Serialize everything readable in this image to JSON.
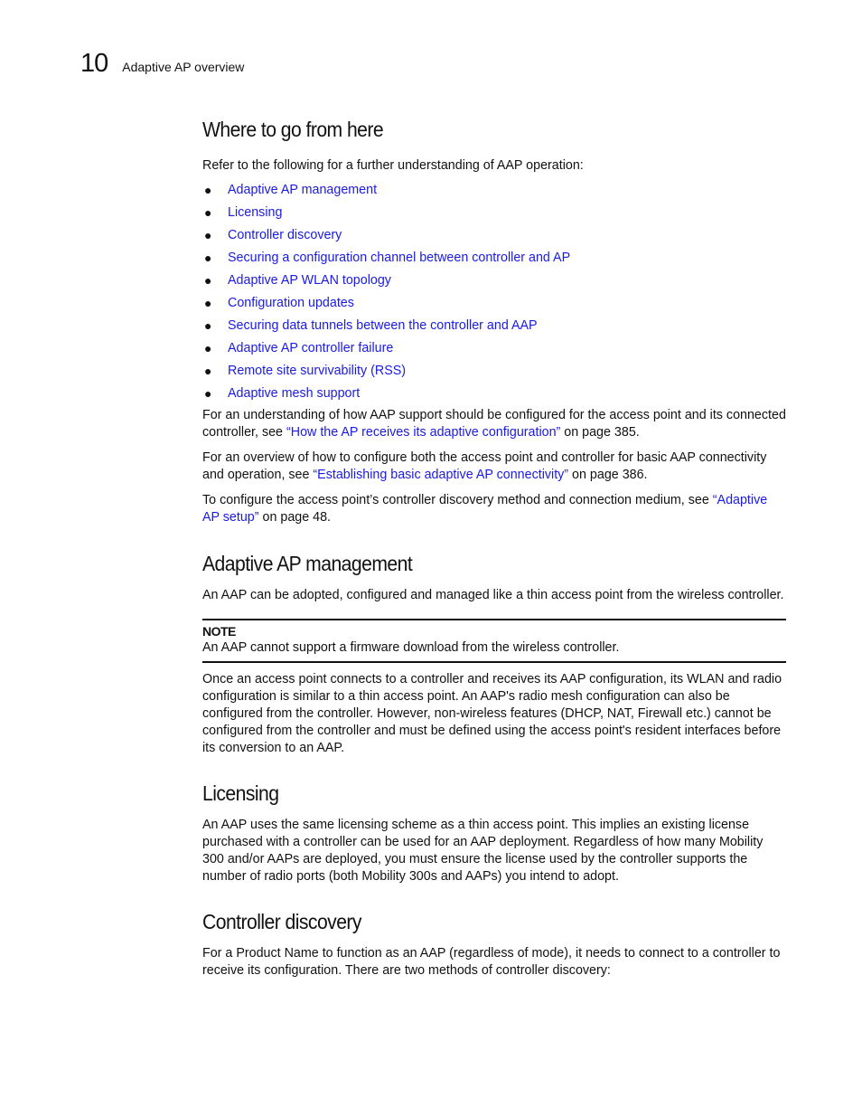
{
  "running_head": {
    "chapter_number": "10",
    "chapter_title": "Adaptive AP overview"
  },
  "sections": {
    "where_to_go": {
      "heading": "Where to go from here",
      "intro": "Refer to the following for a further understanding of AAP operation:",
      "links": [
        "Adaptive AP management",
        "Licensing",
        "Controller discovery",
        "Securing a configuration channel between controller and AP",
        "Adaptive AP WLAN topology",
        "Configuration updates",
        "Securing data tunnels between the controller and AAP",
        "Adaptive AP controller failure",
        "Remote site survivability (RSS)",
        "Adaptive mesh support"
      ],
      "para1": {
        "before": "For an understanding of how AAP support should be configured for the access point and its connected controller, see ",
        "link": "“How the AP receives its adaptive configuration”",
        "after": " on page 385."
      },
      "para2": {
        "before": "For an overview of how to configure both the access point and controller for basic AAP connectivity and operation, see ",
        "link": "“Establishing basic adaptive AP connectivity”",
        "after": " on page 386."
      },
      "para3": {
        "before": "To configure the access point’s controller discovery method and connection medium, see ",
        "link": "“Adaptive AP setup”",
        "after": " on page 48."
      }
    },
    "management": {
      "heading": "Adaptive AP management",
      "para1": "An AAP can be adopted, configured and managed like a thin access point from the wireless controller.",
      "note_label": "NOTE",
      "note_text": "An AAP cannot support a firmware download from the wireless controller.",
      "para2": "Once an access point connects to a controller and receives its AAP configuration, its WLAN and radio configuration is similar to a thin access point. An AAP's radio mesh configuration can also be configured from the controller. However, non-wireless features (DHCP, NAT, Firewall etc.) cannot be configured from the controller and must be defined using the access point's resident interfaces before its conversion to an AAP."
    },
    "licensing": {
      "heading": "Licensing",
      "para1": "An AAP uses the same licensing scheme as a thin access point. This implies an existing license purchased with a controller can be used for an AAP deployment. Regardless of how many Mobility 300 and/or AAPs are deployed, you must ensure the license used by the controller supports the number of radio ports (both Mobility 300s and AAPs) you intend to adopt."
    },
    "discovery": {
      "heading": "Controller discovery",
      "para1": "For a Product Name to function as an AAP (regardless of mode), it needs to connect to a controller to receive its configuration. There are two methods of controller discovery:"
    }
  },
  "colors": {
    "link": "#1a1ae6",
    "text": "#111111"
  }
}
